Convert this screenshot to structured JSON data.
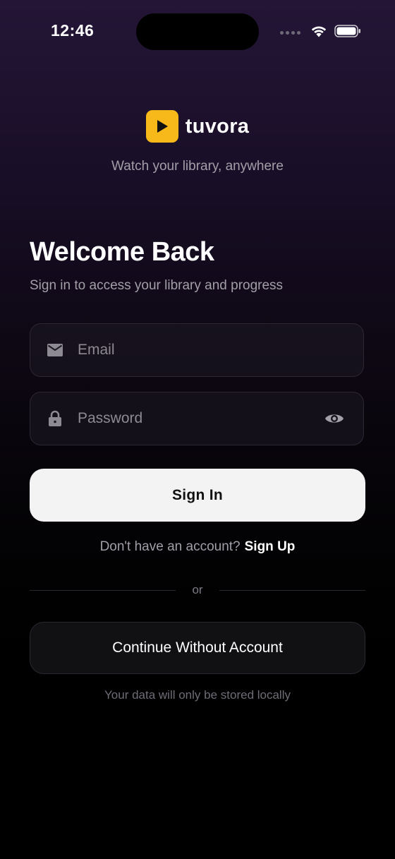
{
  "status_bar": {
    "time": "12:46",
    "icons": [
      "signal-dots-icon",
      "wifi-icon",
      "battery-icon"
    ]
  },
  "brand": {
    "name": "tuvora",
    "logo_icon": "play-icon",
    "accent_color": "#f7b91a",
    "tagline": "Watch your library, anywhere"
  },
  "login": {
    "title": "Welcome Back",
    "subtitle": "Sign in to access your library and progress",
    "email": {
      "placeholder": "Email",
      "value": "",
      "icon": "mail-icon"
    },
    "password": {
      "placeholder": "Password",
      "value": "",
      "icon": "lock-icon",
      "toggle_icon": "eye-icon"
    },
    "sign_in_label": "Sign In",
    "signup_prompt": "Don't have an account?",
    "signup_link": "Sign Up",
    "divider_label": "or",
    "guest_label": "Continue Without Account",
    "guest_note": "Your data will only be stored locally"
  }
}
